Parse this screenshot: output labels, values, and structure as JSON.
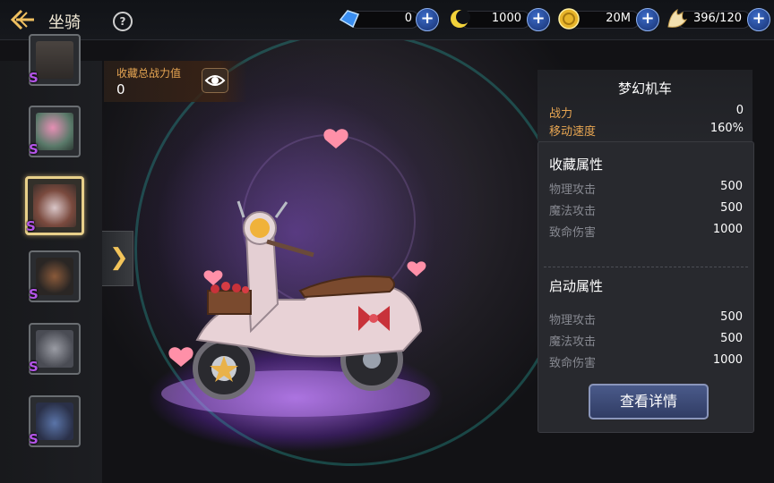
{
  "header": {
    "title": "坐骑",
    "help_label": "?",
    "resources": [
      {
        "icon": "blue-crystal-icon",
        "value": "0"
      },
      {
        "icon": "yellow-crescent-icon",
        "value": "1000"
      },
      {
        "icon": "gold-coin-icon",
        "value": "20M"
      },
      {
        "icon": "wing-stamina-icon",
        "value": "396/120"
      }
    ]
  },
  "collection_power": {
    "label": "收藏总战力值",
    "value": "0"
  },
  "mount_list": [
    {
      "rank": "S",
      "selected": false,
      "icon": "mount-thumb-partial"
    },
    {
      "rank": "S",
      "selected": false,
      "icon": "mount-thumb-pink-creature"
    },
    {
      "rank": "S",
      "selected": true,
      "icon": "mount-thumb-scooter"
    },
    {
      "rank": "S",
      "selected": false,
      "icon": "mount-thumb-dark-beast"
    },
    {
      "rank": "S",
      "selected": false,
      "icon": "mount-thumb-grey-wolf"
    },
    {
      "rank": "S",
      "selected": false,
      "icon": "mount-thumb-blue-cloud"
    }
  ],
  "mount": {
    "name": "梦幻机车",
    "power_label": "战力",
    "power_value": "0",
    "speed_label": "移动速度",
    "speed_value": "160%"
  },
  "collection_attrs": {
    "title": "收藏属性",
    "rows": [
      {
        "label": "物理攻击",
        "value": "500"
      },
      {
        "label": "魔法攻击",
        "value": "500"
      },
      {
        "label": "致命伤害",
        "value": "1000"
      }
    ]
  },
  "active_attrs": {
    "title": "启动属性",
    "rows": [
      {
        "label": "物理攻击",
        "value": "500"
      },
      {
        "label": "魔法攻击",
        "value": "500"
      },
      {
        "label": "致命伤害",
        "value": "1000"
      }
    ]
  },
  "detail_button": "查看详情",
  "colors": {
    "accent_orange": "#e6a552",
    "rank_purple": "#b455e8",
    "selected_border": "#e8d08a"
  }
}
